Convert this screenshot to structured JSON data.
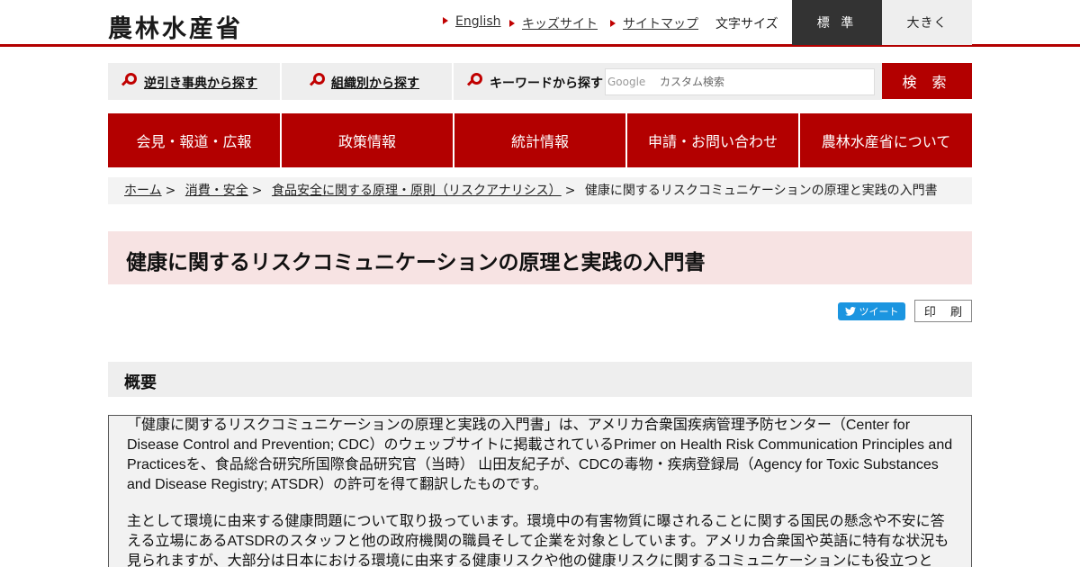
{
  "header": {
    "logo": "農林水産省",
    "utility_links": [
      "English",
      "キッズサイト",
      "サイトマップ"
    ],
    "font_size_label": "文字サイズ",
    "font_size_standard": "標 準",
    "font_size_large": "大きく"
  },
  "search": {
    "reverse_lookup": "逆引き事典から探す",
    "by_org": "組織別から探す",
    "keyword_label": "キーワードから探す",
    "brand": "Google",
    "placeholder": "カスタム検索",
    "button": "検 索"
  },
  "nav": {
    "items": [
      "会見・報道・広報",
      "政策情報",
      "統計情報",
      "申請・お問い合わせ",
      "農林水産省について"
    ]
  },
  "breadcrumb": {
    "items": [
      "ホーム",
      "消費・安全",
      "食品安全に関する原理・原則（リスクアナリシス）"
    ],
    "current": "健康に関するリスクコミュニケーションの原理と実践の入門書",
    "separator": ">"
  },
  "page": {
    "title": "健康に関するリスクコミュニケーションの原理と実践の入門書",
    "tweet": "ツイート",
    "print": "印 刷"
  },
  "section": {
    "heading": "概要",
    "paragraphs": [
      "「健康に関するリスクコミュニケーションの原理と実践の入門書」は、アメリカ合衆国疾病管理予防センター（Center for Disease Control and Prevention; CDC）のウェッブサイトに掲載されているPrimer on Health Risk Communication Principles and Practicesを、食品総合研究所国際食品研究官（当時） 山田友紀子が、CDCの毒物・疾病登録局（Agency for Toxic Substances and Disease Registry; ATSDR）の許可を得て翻訳したものです。",
      "主として環境に由来する健康問題について取り扱っています。環境中の有害物質に曝されることに関する国民の懸念や不安に答える立場にあるATSDRのスタッフと他の政府機関の職員そして企業を対象としています。アメリカ合衆国や英語に特有な状況も見られますが、大部分は日本における環境に由来する健康リスクや他の健康リスクに関するコミュニケーションにも役立つと"
    ]
  },
  "colors": {
    "accent": "#b30000",
    "title_bg": "#f7e3e3",
    "tweet": "#1b95e0"
  }
}
